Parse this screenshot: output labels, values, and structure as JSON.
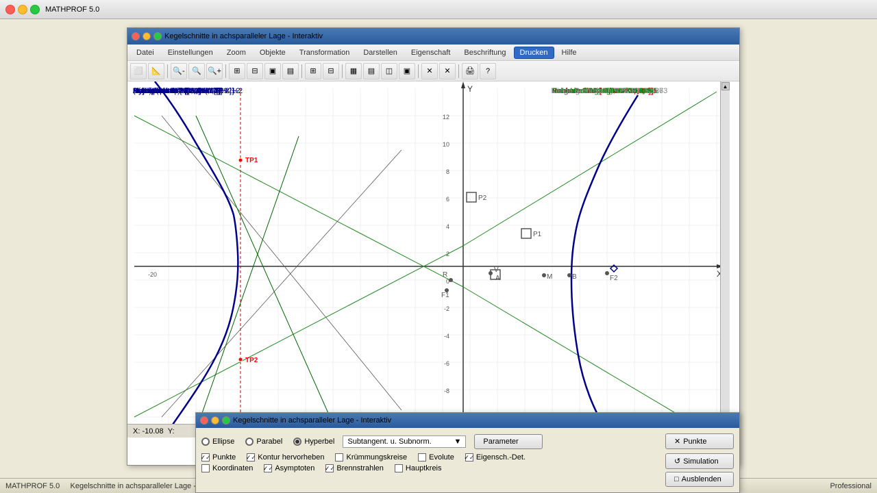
{
  "app": {
    "title": "MATHPROF 5.0",
    "status_left": "MATHPROF 5.0",
    "status_middle": "Kegelschnitte in achsparalleler Lage - Interaktiv",
    "status_right": "Professional"
  },
  "main_window": {
    "title": "Kegelschnitte in achsparalleler Lage - Interaktiv",
    "menu": [
      {
        "label": "Datei",
        "active": false
      },
      {
        "label": "Einstellungen",
        "active": false
      },
      {
        "label": "Zoom",
        "active": false
      },
      {
        "label": "Objekte",
        "active": false
      },
      {
        "label": "Transformation",
        "active": false
      },
      {
        "label": "Darstellen",
        "active": false
      },
      {
        "label": "Eigenschaft",
        "active": false
      },
      {
        "label": "Beschriftung",
        "active": false
      },
      {
        "label": "Drucken",
        "active": true
      },
      {
        "label": "Hilfe",
        "active": false
      }
    ]
  },
  "graph": {
    "hyperbel_label": "Hyperbel:",
    "hyperbel_eq": "(X+2)²/(3,344)²-[Y-2]²/(4,3)² = 1",
    "halbachse_a": "Halbachse a = 3,344",
    "halbachse_b": "Halbachse b = 4,3",
    "parameter_2p": "Parameter 2p = 11,062",
    "lin_exzentrizitat": "Lin. Exzentrizität e = 5,447",
    "num_exzentrizitat": "Num. Exzentrizität e = 1,629",
    "scheitelpunkt_a": "Scheitelpunkt A [-5,344 / 2]",
    "scheitelpunkt_b": "Scheitelpunkt B [1,344 / 2]",
    "mittelpunkt_m": "Mittelpunkt M [-2 / 2]",
    "brennpunkt_f1": "Brennpunkt F1 [-7,447 / 2]",
    "brennpunkt_f2": "Brennpunkt F2 [3,447 / 2]",
    "asymptote_1": "Asymptote 1: Y = 1,286·[X+2]+2",
    "asymptote_2": "Asymptote 2: Y = -1,286·[X+2]+2",
    "untersuchte_stelle": "Untersuchte Stelle: X = -7,481",
    "punkt1": "Punkt 1: TP1 [-7,481 / 7,586]",
    "punkt2": "Punkt 2: TP2 [-7,481 / -3,586]",
    "tangente1": "Tangente 1: Y = -1,623·X-4,557",
    "tangente2": "Tangente 2: Y = 1,623·X+8,557",
    "tangentenlaenge": "Tangentenlänge TP1-V: 6,561",
    "subtangentenlaenge": "Subtangentenlänge R-V: 3,441",
    "normale1": "Normale 1: Y = 0,616·X+12,195",
    "normale2": "Normale 2: Y= -0,616·X-8,195",
    "normalenlaenge": "Normalenlänge TP1-T: 10,649",
    "subnormalenlaenge": "Subnormalenlänge R-T: 9,066",
    "brennstrahl_f1": "Länge Brennstrahl TP1-F1: 5,586",
    "brennstrahl_f2": "Länge Brennstrahl TP1-F2: 12,273",
    "coord_x": "X: -10.08",
    "coord_y": "Y:"
  },
  "dialog": {
    "title": "Kegelschnitte in achsparalleler Lage - Interaktiv",
    "radio_options": [
      {
        "label": "Ellipse",
        "selected": false
      },
      {
        "label": "Parabel",
        "selected": false
      },
      {
        "label": "Hyperbel",
        "selected": true
      }
    ],
    "dropdown_label": "Subtangent. u. Subnorm.",
    "checkboxes_row1": [
      {
        "label": "Punkte",
        "checked": true
      },
      {
        "label": "Kontur hervorheben",
        "checked": true
      },
      {
        "label": "Krümmungskreise",
        "checked": false
      },
      {
        "label": "Evolute",
        "checked": false
      },
      {
        "label": "Eigensch.-Det.",
        "checked": true
      }
    ],
    "checkboxes_row2": [
      {
        "label": "Koordinaten",
        "checked": false
      },
      {
        "label": "Asymptoten",
        "checked": true
      },
      {
        "label": "Brennstrahlen",
        "checked": true
      },
      {
        "label": "Hauptkreis",
        "checked": false
      }
    ],
    "buttons": [
      {
        "label": "Punkte",
        "icon": "×"
      },
      {
        "label": "Simulation",
        "icon": "↺"
      },
      {
        "label": "Ausblenden",
        "icon": "□"
      }
    ],
    "parameter_btn": "Parameter"
  }
}
